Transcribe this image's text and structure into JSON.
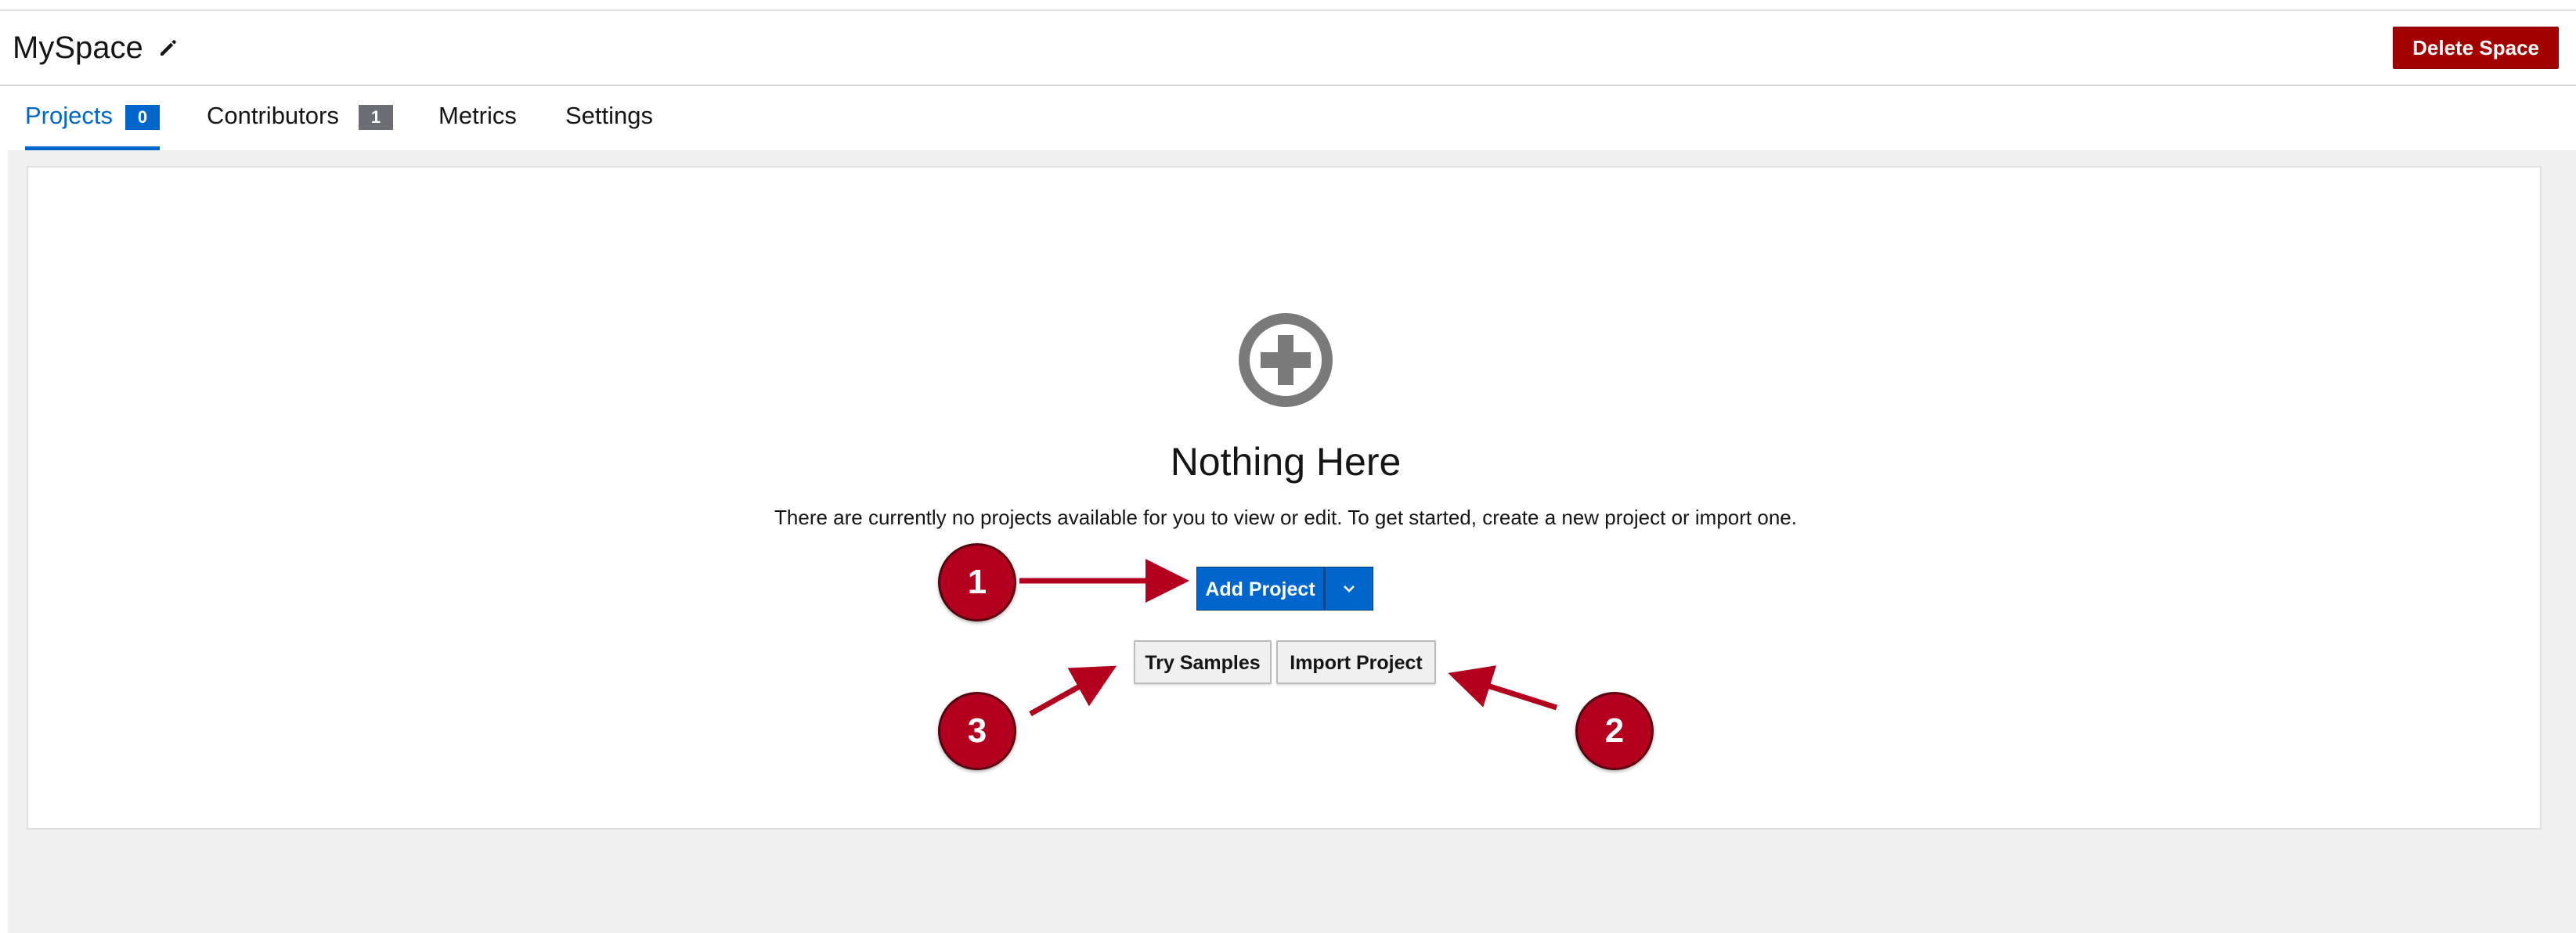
{
  "header": {
    "title": "MySpace",
    "edit_icon": "pencil-icon",
    "delete_label": "Delete Space"
  },
  "tabs": [
    {
      "label": "Projects",
      "badge": "0",
      "active": true
    },
    {
      "label": "Contributors",
      "badge": "1",
      "active": false
    },
    {
      "label": "Metrics",
      "active": false
    },
    {
      "label": "Settings",
      "active": false
    }
  ],
  "empty_state": {
    "icon": "plus-circle-icon",
    "title": "Nothing Here",
    "text": "There are currently no projects available for you to view or edit. To get started, create a new project or import one.",
    "primary_label": "Add Project",
    "dropdown_icon": "chevron-down-icon",
    "try_samples_label": "Try Samples",
    "import_label": "Import Project"
  },
  "callouts": {
    "one": "1",
    "two": "2",
    "three": "3"
  },
  "colors": {
    "accent": "#0066cc",
    "danger": "#a30000",
    "callout": "#b3001f",
    "badge_active": "#0066cc",
    "badge_inactive": "#6a6e73"
  }
}
